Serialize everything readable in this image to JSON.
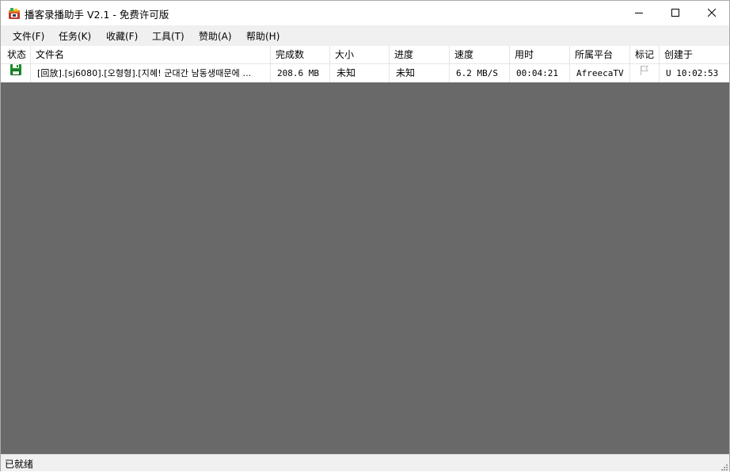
{
  "window": {
    "title": "播客录播助手 V2.1 - 免费许可版"
  },
  "menu": [
    {
      "label": "文件(F)"
    },
    {
      "label": "任务(K)"
    },
    {
      "label": "收藏(F)"
    },
    {
      "label": "工具(T)"
    },
    {
      "label": "赞助(A)"
    },
    {
      "label": "帮助(H)"
    }
  ],
  "table": {
    "columns": [
      "状态",
      "文件名",
      "完成数",
      "大小",
      "进度",
      "速度",
      "用时",
      "所属平台",
      "标记",
      "创建于"
    ],
    "rows": [
      {
        "status_icon": "save-icon",
        "filename": "[回放].[sj6080].[오형형].[지혜! 군대간 남동생때문에 ...",
        "completed": "208.6 MB",
        "size": "未知",
        "progress": "未知",
        "speed": "6.2 MB/S",
        "elapsed": "00:04:21",
        "platform": "AfreecaTV",
        "mark_icon": "flag-icon",
        "created": "U 10:02:53"
      }
    ]
  },
  "statusbar": {
    "text": "已就绪"
  },
  "colors": {
    "list_background": "#696969",
    "menubar": "#f0f0f0",
    "save_icon": "#1a8a2a"
  }
}
